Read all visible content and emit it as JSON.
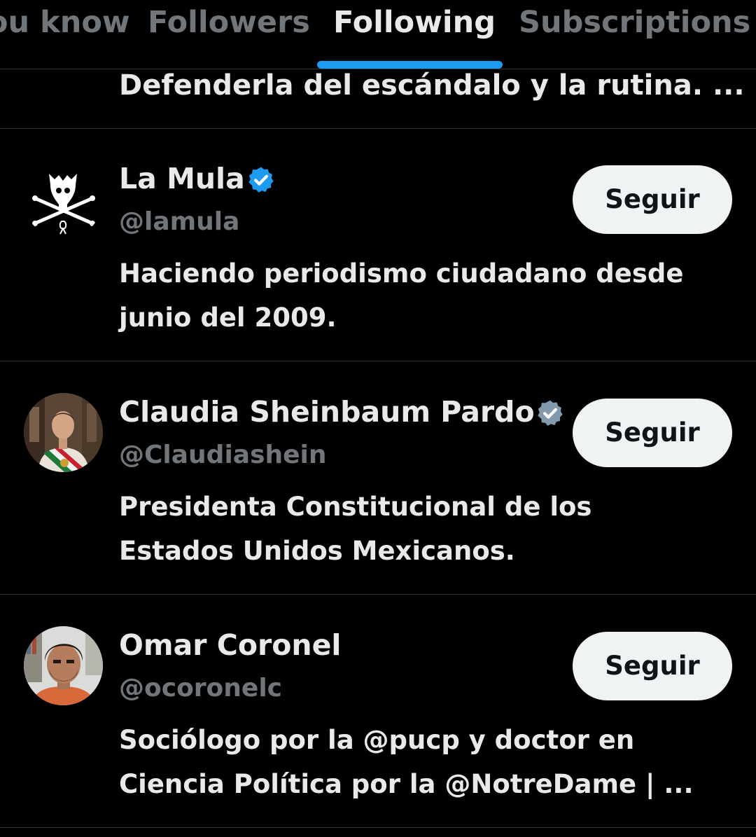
{
  "tabs": [
    {
      "label": "ou know",
      "active": false
    },
    {
      "label": "Followers",
      "active": false
    },
    {
      "label": "Following",
      "active": true
    },
    {
      "label": "Subscriptions",
      "active": false
    }
  ],
  "partial_row": {
    "bio": "Defenderla del escándalo y la rutina. ..."
  },
  "users": [
    {
      "display_name": "La Mula",
      "verified": "blue",
      "handle": "@lamula",
      "bio_lines": [
        "Haciendo periodismo ciudadano desde",
        "junio del 2009."
      ],
      "follow_label": "Seguir",
      "avatar_icon": "skull-crossbones-logo"
    },
    {
      "display_name": "Claudia Sheinbaum Pardo",
      "verified": "gray",
      "handle": "@Claudiashein",
      "bio_lines": [
        "Presidenta Constitucional de los",
        "Estados Unidos Mexicanos."
      ],
      "follow_label": "Seguir",
      "avatar_icon": "profile-photo"
    },
    {
      "display_name": "Omar Coronel",
      "verified": "none",
      "handle": "@ocoronelc",
      "bio_lines": [
        "Sociólogo por la @pucp y doctor en",
        "Ciencia Política por la @NotreDame | ..."
      ],
      "follow_label": "Seguir",
      "avatar_icon": "profile-photo"
    }
  ],
  "colors": {
    "background": "#000000",
    "primary_text": "#e7e9ea",
    "secondary_text": "#71767b",
    "divider": "#2f3336",
    "accent": "#1d9bf0",
    "verified_gray": "#829aab",
    "button_bg": "#eff3f4"
  }
}
